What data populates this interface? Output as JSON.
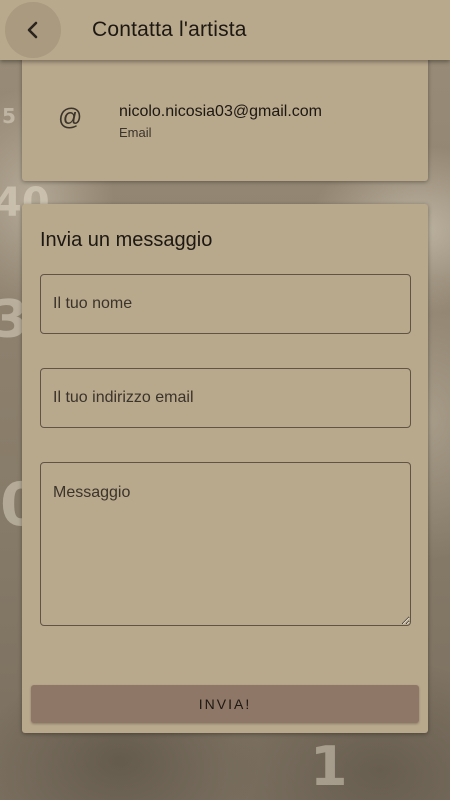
{
  "header": {
    "title": "Contatta l'artista",
    "back_icon": "chevron-left-icon"
  },
  "contact": {
    "icon": "at-sign-icon",
    "icon_glyph": "@",
    "value": "nicolo.nicosia03@gmail.com",
    "label": "Email"
  },
  "form": {
    "title": "Invia un messaggio",
    "name_placeholder": "Il tuo nome",
    "email_placeholder": "Il tuo indirizzo email",
    "message_placeholder": "Messaggio",
    "submit_label": "INVIA!"
  },
  "colors": {
    "surface": "#b8a88c",
    "button": "#8f7767",
    "text": "#1d1812"
  }
}
